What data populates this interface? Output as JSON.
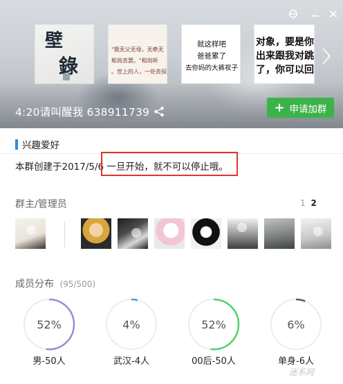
{
  "window": {
    "pin_icon": "pin-icon",
    "min_icon": "minimize-icon",
    "close_icon": "close-icon"
  },
  "header": {
    "group_name": "4:20请叫醒我 638911739",
    "join_label": "申请加群",
    "thumbnails": [
      {
        "kind": "calligraphy",
        "chars": [
          "壁",
          "錄"
        ]
      },
      {
        "kind": "poem",
        "lines": [
          "\"我无父无母，无牵无",
          "和尚去罢。\"和尚听",
          "。世上的人，一处去探"
        ]
      },
      {
        "kind": "sticker",
        "lines": [
          "就这样吧",
          "爸爸累了",
          "去你妈的大裤衩子"
        ]
      },
      {
        "kind": "text",
        "lines": [
          "对象，要是你",
          "出来跟我对跳",
          "了，你可以回"
        ]
      }
    ]
  },
  "interests": {
    "heading": "兴趣爱好",
    "intro": "本群创建于2017/5/6   一旦开始，就不可以停止哦。"
  },
  "admins": {
    "heading": "群主/管理员",
    "page_other": "1",
    "page_current": "2",
    "count": 8
  },
  "distribution": {
    "heading": "成员分布",
    "count": "(95/500)",
    "stats": [
      {
        "pct": "52%",
        "label": "男-50人",
        "value": 0.52,
        "color": "#9b8ad7"
      },
      {
        "pct": "4%",
        "label": "武汉-4人",
        "value": 0.04,
        "color": "#3a9ef2"
      },
      {
        "pct": "52%",
        "label": "00后-50人",
        "value": 0.52,
        "color": "#4cd36a"
      },
      {
        "pct": "6%",
        "label": "单身-6人",
        "value": 0.06,
        "color": "#5a5a5a"
      }
    ]
  },
  "colors": {
    "join_button": "#3cb34a",
    "section_tag": "#2a8fde",
    "highlight": "#e0362c",
    "ring_track": "#ececec"
  },
  "watermark": "迷系网"
}
